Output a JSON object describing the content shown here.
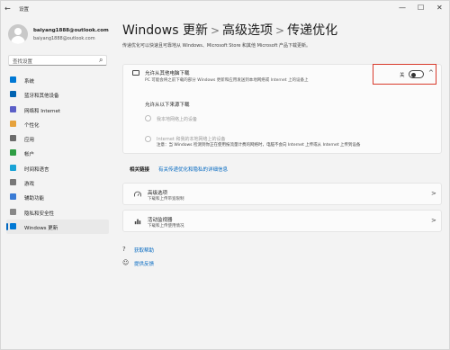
{
  "window": {
    "app_title": "设置",
    "back_icon": "←",
    "min_icon": "—",
    "max_icon": "☐",
    "close_icon": "✕"
  },
  "user": {
    "name": "baiyang1888@outlook.com",
    "email": "baiyang1888@outlook.com"
  },
  "search": {
    "placeholder": "查找设置",
    "icon": "⌕"
  },
  "nav": {
    "items": [
      {
        "label": "系统",
        "icon_color": "#0078d4"
      },
      {
        "label": "蓝牙和其他设备",
        "icon_color": "#0063b1"
      },
      {
        "label": "网络和 Internet",
        "icon_color": "#5b5fc7"
      },
      {
        "label": "个性化",
        "icon_color": "#e6a23c"
      },
      {
        "label": "应用",
        "icon_color": "#6b6b6b"
      },
      {
        "label": "帐户",
        "icon_color": "#2f9e44"
      },
      {
        "label": "时间和语言",
        "icon_color": "#1aa3d6"
      },
      {
        "label": "游戏",
        "icon_color": "#777777"
      },
      {
        "label": "辅助功能",
        "icon_color": "#3a7bd5"
      },
      {
        "label": "隐私和安全性",
        "icon_color": "#888888"
      },
      {
        "label": "Windows 更新",
        "icon_color": "#0078d4"
      }
    ]
  },
  "breadcrumb": {
    "part1": "Windows 更新",
    "sep1": ">",
    "part2": "高级选项",
    "sep2": ">",
    "part3": "传递优化"
  },
  "page": {
    "description": "传递优化可以快速且可靠地从 Windows、Microsoft Store 和其他 Microsoft 产品下载更新。"
  },
  "allow_downloads": {
    "title": "允许从其他电脑下载",
    "description": "PC 可能会将之前下载的部分 Windows 更新和应用发送到本地网络或 Internet 上的设备上",
    "toggle_label": "关",
    "chevron": "^",
    "sub_heading": "允许从以下来源下载",
    "option1": "我本地网络上的设备",
    "option2": "Internet 和我的本地网络上的设备",
    "option2_note": "注意：当 Windows 检测到你正在使用按流量计费的网络时，电脑不会向 Internet 上传或从 Internet 上传到设备"
  },
  "related": {
    "heading": "相关链接",
    "link": "有关传递优化和隐私的详细信息"
  },
  "advanced_options": {
    "title": "高级选项",
    "description": "下载和上传带宽限制",
    "arrow": ">"
  },
  "activity_monitor": {
    "title": "活动监视器",
    "description": "下载和上传使用情况",
    "arrow": ">"
  },
  "footer": {
    "help": "获取帮助",
    "feedback": "提供反馈",
    "help_icon": "?",
    "feedback_icon": "☺"
  }
}
